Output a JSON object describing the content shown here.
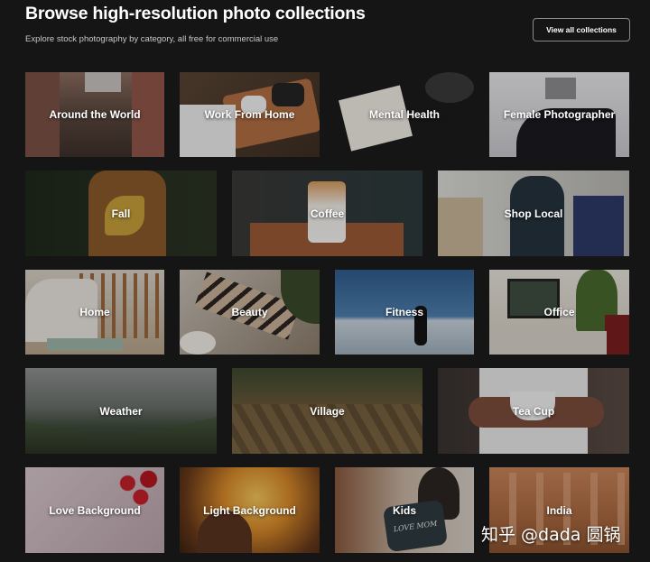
{
  "header": {
    "title": "Browse high-resolution photo collections",
    "subtitle": "Explore stock photography by category, all free for commercial use",
    "view_all_label": "View all collections"
  },
  "collections": {
    "around_the_world": "Around the World",
    "work_from_home": "Work From Home",
    "mental_health": "Mental Health",
    "female_photographer": "Female Photographer",
    "fall": "Fall",
    "coffee": "Coffee",
    "shop_local": "Shop Local",
    "home": "Home",
    "beauty": "Beauty",
    "fitness": "Fitness",
    "office": "Office",
    "weather": "Weather",
    "village": "Village",
    "tea_cup": "Tea Cup",
    "love_background": "Love Background",
    "light_background": "Light Background",
    "kids": "Kids",
    "india": "India"
  },
  "photo_text": {
    "mug_lettering": "LOVE MOM"
  },
  "watermark": {
    "text": "知乎 @dada 圆锅"
  },
  "colors": {
    "page_background": "#151515",
    "text": "#ffffff"
  }
}
